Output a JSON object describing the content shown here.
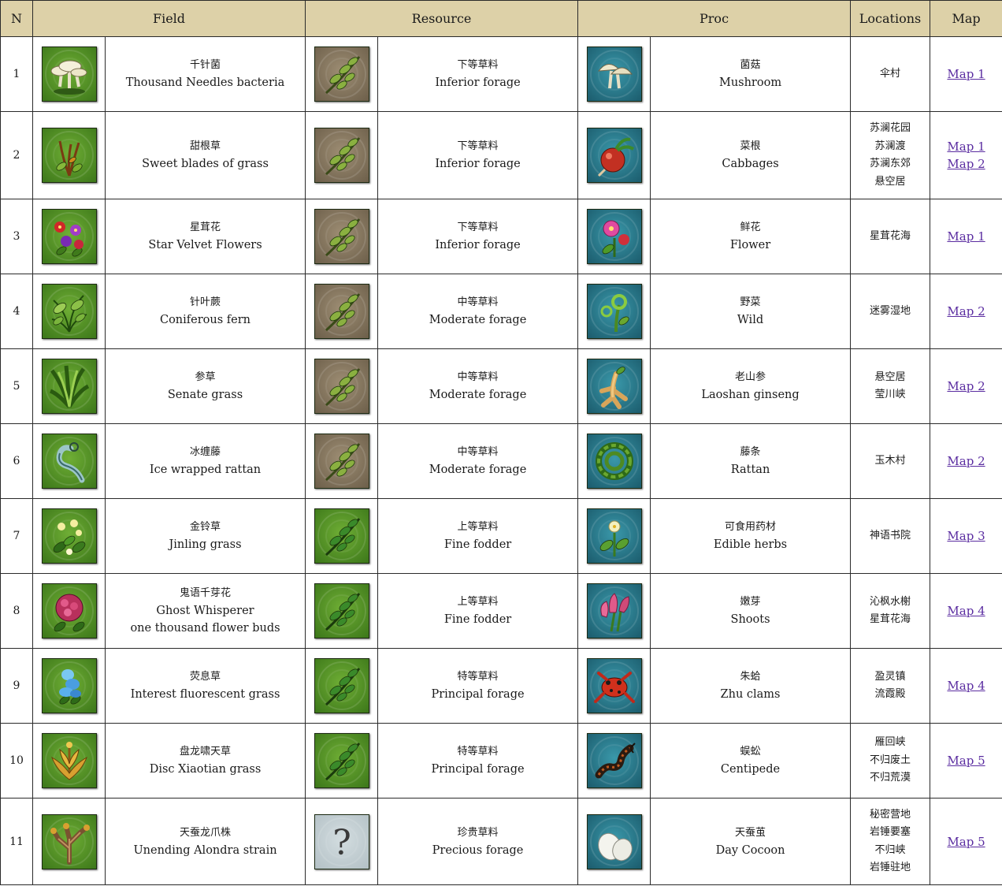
{
  "headers": {
    "n": "N",
    "field": "Field",
    "resource": "Resource",
    "proc": "Proc",
    "locations": "Locations",
    "map": "Map"
  },
  "rows": [
    {
      "n": "1",
      "field": {
        "cn": "千针菌",
        "en": [
          "Thousand Needles bacteria"
        ],
        "icon": "mushroom-cluster-icon"
      },
      "resource": {
        "cn": "下等草料",
        "en": "Inferior forage",
        "icon": "inferior-forage-icon"
      },
      "proc": {
        "cn": "菌菇",
        "en": "Mushroom",
        "icon": "mushroom-icon"
      },
      "locations": [
        "伞村"
      ],
      "maps": [
        "Map 1"
      ]
    },
    {
      "n": "2",
      "field": {
        "cn": "甜根草",
        "en": [
          "Sweet blades of grass"
        ],
        "icon": "sweet-grass-icon"
      },
      "resource": {
        "cn": "下等草料",
        "en": "Inferior forage",
        "icon": "inferior-forage-icon"
      },
      "proc": {
        "cn": "菜根",
        "en": "Cabbages",
        "icon": "radish-icon"
      },
      "locations": [
        "苏澜花园",
        "苏澜渡",
        "苏澜东郊",
        "悬空居"
      ],
      "maps": [
        "Map 1",
        "Map 2"
      ]
    },
    {
      "n": "3",
      "field": {
        "cn": "星茸花",
        "en": [
          "Star Velvet Flowers"
        ],
        "icon": "star-velvet-flower-icon"
      },
      "resource": {
        "cn": "下等草料",
        "en": "Inferior forage",
        "icon": "inferior-forage-icon"
      },
      "proc": {
        "cn": "鲜花",
        "en": "Flower",
        "icon": "flower-icon"
      },
      "locations": [
        "星茸花海"
      ],
      "maps": [
        "Map 1"
      ]
    },
    {
      "n": "4",
      "field": {
        "cn": "针叶蕨",
        "en": [
          "Coniferous fern"
        ],
        "icon": "fern-icon"
      },
      "resource": {
        "cn": "中等草料",
        "en": "Moderate forage",
        "icon": "moderate-forage-icon"
      },
      "proc": {
        "cn": "野菜",
        "en": "Wild",
        "icon": "wild-vegetable-icon"
      },
      "locations": [
        "迷雾湿地"
      ],
      "maps": [
        "Map 2"
      ]
    },
    {
      "n": "5",
      "field": {
        "cn": "参草",
        "en": [
          "Senate grass"
        ],
        "icon": "senate-grass-icon"
      },
      "resource": {
        "cn": "中等草料",
        "en": "Moderate forage",
        "icon": "moderate-forage-icon"
      },
      "proc": {
        "cn": "老山参",
        "en": "Laoshan ginseng",
        "icon": "ginseng-icon"
      },
      "locations": [
        "悬空居",
        "莹川峡"
      ],
      "maps": [
        "Map 2"
      ]
    },
    {
      "n": "6",
      "field": {
        "cn": "冰缠藤",
        "en": [
          "Ice wrapped rattan"
        ],
        "icon": "ice-rattan-icon"
      },
      "resource": {
        "cn": "中等草料",
        "en": "Moderate forage",
        "icon": "moderate-forage-icon"
      },
      "proc": {
        "cn": "藤条",
        "en": "Rattan",
        "icon": "rattan-icon"
      },
      "locations": [
        "玉木村"
      ],
      "maps": [
        "Map 2"
      ]
    },
    {
      "n": "7",
      "field": {
        "cn": "金铃草",
        "en": [
          "Jinling grass"
        ],
        "icon": "jinling-grass-icon"
      },
      "resource": {
        "cn": "上等草料",
        "en": "Fine fodder",
        "icon": "fine-fodder-icon"
      },
      "proc": {
        "cn": "可食用药材",
        "en": "Edible herbs",
        "icon": "edible-herb-icon"
      },
      "locations": [
        "神语书院"
      ],
      "maps": [
        "Map 3"
      ]
    },
    {
      "n": "8",
      "field": {
        "cn": "鬼语千芽花",
        "en": [
          "Ghost Whisperer",
          "one thousand flower buds"
        ],
        "icon": "ghost-flower-icon"
      },
      "resource": {
        "cn": "上等草料",
        "en": "Fine fodder",
        "icon": "fine-fodder-icon"
      },
      "proc": {
        "cn": "嫩芽",
        "en": "Shoots",
        "icon": "shoots-icon"
      },
      "locations": [
        "沁枫水榭",
        "星茸花海"
      ],
      "maps": [
        "Map 4"
      ]
    },
    {
      "n": "9",
      "field": {
        "cn": "荧息草",
        "en": [
          "Interest fluorescent grass"
        ],
        "icon": "fluorescent-grass-icon"
      },
      "resource": {
        "cn": "特等草料",
        "en": "Principal forage",
        "icon": "principal-forage-icon"
      },
      "proc": {
        "cn": "朱蛤",
        "en": "Zhu clams",
        "icon": "red-frog-icon"
      },
      "locations": [
        "盈灵镇",
        "流霞殿"
      ],
      "maps": [
        "Map 4"
      ]
    },
    {
      "n": "10",
      "field": {
        "cn": "盘龙啸天草",
        "en": [
          "Disc Xiaotian grass"
        ],
        "icon": "golden-grass-icon"
      },
      "resource": {
        "cn": "特等草料",
        "en": "Principal forage",
        "icon": "principal-forage-icon"
      },
      "proc": {
        "cn": "蜈蚣",
        "en": "Centipede",
        "icon": "centipede-icon"
      },
      "locations": [
        "雁回峡",
        "不归废土",
        "不归荒漠"
      ],
      "maps": [
        "Map 5"
      ]
    },
    {
      "n": "11",
      "field": {
        "cn": "天蚕龙爪株",
        "en": [
          "Unending Alondra strain"
        ],
        "icon": "dragon-claw-plant-icon"
      },
      "resource": {
        "cn": "珍贵草料",
        "en": "Precious forage",
        "icon": "question-mark-icon"
      },
      "proc": {
        "cn": "天蚕茧",
        "en": "Day Cocoon",
        "icon": "cocoon-icon"
      },
      "locations": [
        "秘密营地",
        "岩锤要塞",
        "不归峡",
        "岩锤驻地"
      ],
      "maps": [
        "Map 5"
      ]
    }
  ],
  "colors": {
    "header_bg": "#ddd1a8",
    "green_icon_bg": "#4e8a22",
    "brown_icon_bg": "#8a7a62",
    "teal_icon_bg": "#2a7a8c",
    "grey_icon_bg": "#c9d4d8",
    "link": "#5a2ca0"
  }
}
